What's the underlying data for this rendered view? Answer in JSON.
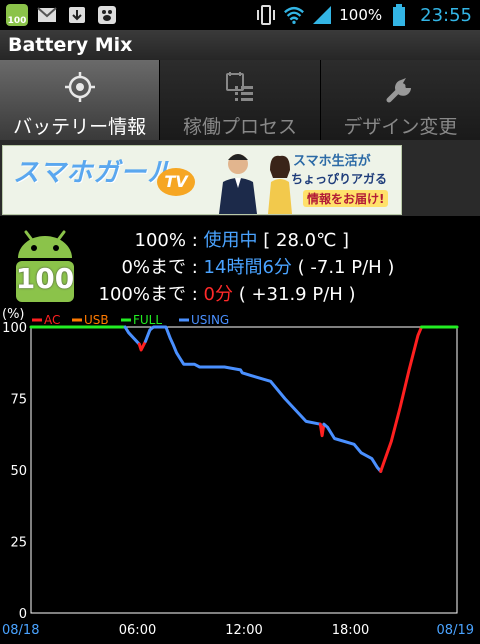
{
  "status_bar": {
    "battery_badge": "100",
    "battery_percent": "100%",
    "time": "23:55",
    "icons": [
      "android-battery-icon",
      "gmail-icon",
      "download-icon",
      "paw-icon",
      "vibrate-icon",
      "wifi-icon",
      "signal-icon",
      "battery-icon"
    ]
  },
  "app": {
    "title": "Battery Mix"
  },
  "tabs": [
    {
      "label": "バッテリー情報",
      "icon": "target-icon",
      "active": true
    },
    {
      "label": "稼働プロセス",
      "icon": "process-list-icon",
      "active": false
    },
    {
      "label": "デザイン変更",
      "icon": "wrench-icon",
      "active": false
    }
  ],
  "banner": {
    "title": "スマホガール",
    "tv": "TV",
    "line1": "スマホ生活が",
    "line2": "ちょっぴりアガる",
    "line3": "情報をお届け!"
  },
  "battery": {
    "badge": "100",
    "line1": {
      "label": "100%",
      "sep": ":",
      "status": "使用中",
      "temp": "[ 28.0℃ ]"
    },
    "line2": {
      "label": "0%まで",
      "sep": ":",
      "time": "14時間6分",
      "rate": "( -7.1 P/H )"
    },
    "line3": {
      "label": "100%まで",
      "sep": ":",
      "time": "0分",
      "rate": "( +31.9 P/H )"
    }
  },
  "colors": {
    "AC": "#ff2020",
    "USB": "#ff7a00",
    "FULL": "#22ee22",
    "USING": "#4a90ff",
    "accent": "#33b5e5"
  },
  "chart_data": {
    "type": "line",
    "y_unit_label": "(%)",
    "legend": [
      "AC",
      "USB",
      "FULL",
      "USING"
    ],
    "ylim": [
      0,
      100
    ],
    "y_ticks": [
      0,
      25,
      50,
      75,
      100
    ],
    "x_ticks": [
      "08/18",
      "06:00",
      "12:00",
      "18:00",
      "08/19"
    ],
    "x_range_hours": [
      0,
      24
    ],
    "segments": [
      {
        "series": "FULL",
        "points": [
          [
            0,
            100
          ],
          [
            5.3,
            100
          ]
        ]
      },
      {
        "series": "USING",
        "points": [
          [
            5.3,
            100
          ],
          [
            5.5,
            98
          ],
          [
            5.8,
            96
          ],
          [
            6.1,
            94
          ]
        ]
      },
      {
        "series": "AC",
        "points": [
          [
            6.1,
            94
          ],
          [
            6.2,
            92
          ],
          [
            6.45,
            95
          ]
        ]
      },
      {
        "series": "USING",
        "points": [
          [
            6.45,
            95
          ],
          [
            6.7,
            99
          ],
          [
            6.9,
            100
          ],
          [
            7.6,
            100
          ],
          [
            7.85,
            96
          ],
          [
            8.0,
            94
          ],
          [
            8.2,
            91
          ],
          [
            8.4,
            89
          ],
          [
            8.6,
            87
          ],
          [
            9.2,
            87
          ],
          [
            9.5,
            86
          ],
          [
            10.9,
            86
          ],
          [
            11.8,
            85
          ],
          [
            11.9,
            84
          ],
          [
            12.4,
            83
          ],
          [
            13.5,
            81
          ],
          [
            14.3,
            75
          ],
          [
            15.5,
            67
          ],
          [
            16.3,
            66
          ]
        ]
      },
      {
        "series": "AC",
        "points": [
          [
            16.3,
            66
          ],
          [
            16.4,
            62
          ],
          [
            16.5,
            66
          ]
        ]
      },
      {
        "series": "USING",
        "points": [
          [
            16.5,
            66
          ],
          [
            16.7,
            65
          ],
          [
            17.1,
            61
          ],
          [
            18.2,
            59
          ],
          [
            18.6,
            56
          ],
          [
            19.2,
            54
          ],
          [
            19.5,
            51
          ],
          [
            19.7,
            49.5
          ]
        ]
      },
      {
        "series": "AC",
        "points": [
          [
            19.7,
            49.5
          ],
          [
            20.3,
            60
          ],
          [
            20.8,
            72
          ],
          [
            21.3,
            85
          ],
          [
            21.8,
            97
          ],
          [
            22.0,
            100
          ]
        ]
      },
      {
        "series": "FULL",
        "points": [
          [
            22.0,
            100
          ],
          [
            24,
            100
          ]
        ]
      }
    ]
  }
}
